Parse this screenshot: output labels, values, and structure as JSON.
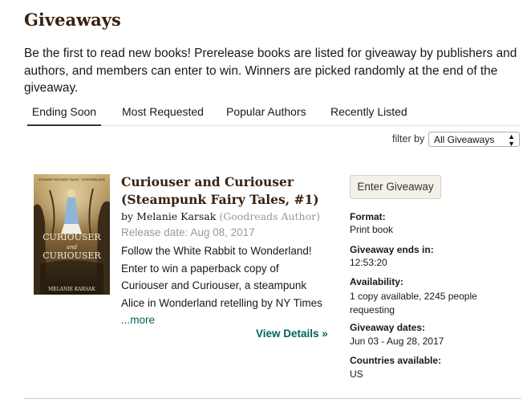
{
  "page": {
    "title": "Giveaways",
    "intro": "Be the first to read new books! Prerelease books are listed for giveaway by publishers and authors, and members can enter to win. Winners are picked randomly at the end of the giveaway."
  },
  "tabs": [
    {
      "label": "Ending Soon",
      "active": true
    },
    {
      "label": "Most Requested",
      "active": false
    },
    {
      "label": "Popular Authors",
      "active": false
    },
    {
      "label": "Recently Listed",
      "active": false
    }
  ],
  "filter": {
    "label": "filter by",
    "selected": "All Giveaways"
  },
  "book": {
    "title": "Curiouser and Curiouser (Steampunk Fairy Tales, #1)",
    "by": "by",
    "author": "Melanie Karsak",
    "author_role": "(Goodreads Author)",
    "release_date": "Release date: Aug 08, 2017",
    "description": "Follow the White Rabbit to Wonderland! Enter to win a paperback copy of Curiouser and Curiouser, a steampunk Alice in Wonderland retelling by NY Times",
    "more_link": "...more",
    "view_details": "View Details »",
    "cover_text": {
      "title_top": "CURIOUSER",
      "title_and": "and",
      "title_bottom": "CURIOUSER",
      "series": "STEAMPUNK FAIRY TALES · WONDERLAND",
      "author": "MELANIE KARSAK"
    }
  },
  "giveaway": {
    "enter_button": "Enter Giveaway",
    "format_label": "Format:",
    "format_value": "Print book",
    "ends_label": "Giveaway ends in:",
    "ends_value": "12:53:20",
    "availability_label": "Availability:",
    "availability_value": "1 copy available, 2245 people requesting",
    "dates_label": "Giveaway dates:",
    "dates_value": "Jun 03 - Aug 28, 2017",
    "countries_label": "Countries available:",
    "countries_value": "US"
  },
  "colors": {
    "brand_brown": "#382110",
    "link_green": "#00635d",
    "button_bg": "#f4f1ea"
  }
}
